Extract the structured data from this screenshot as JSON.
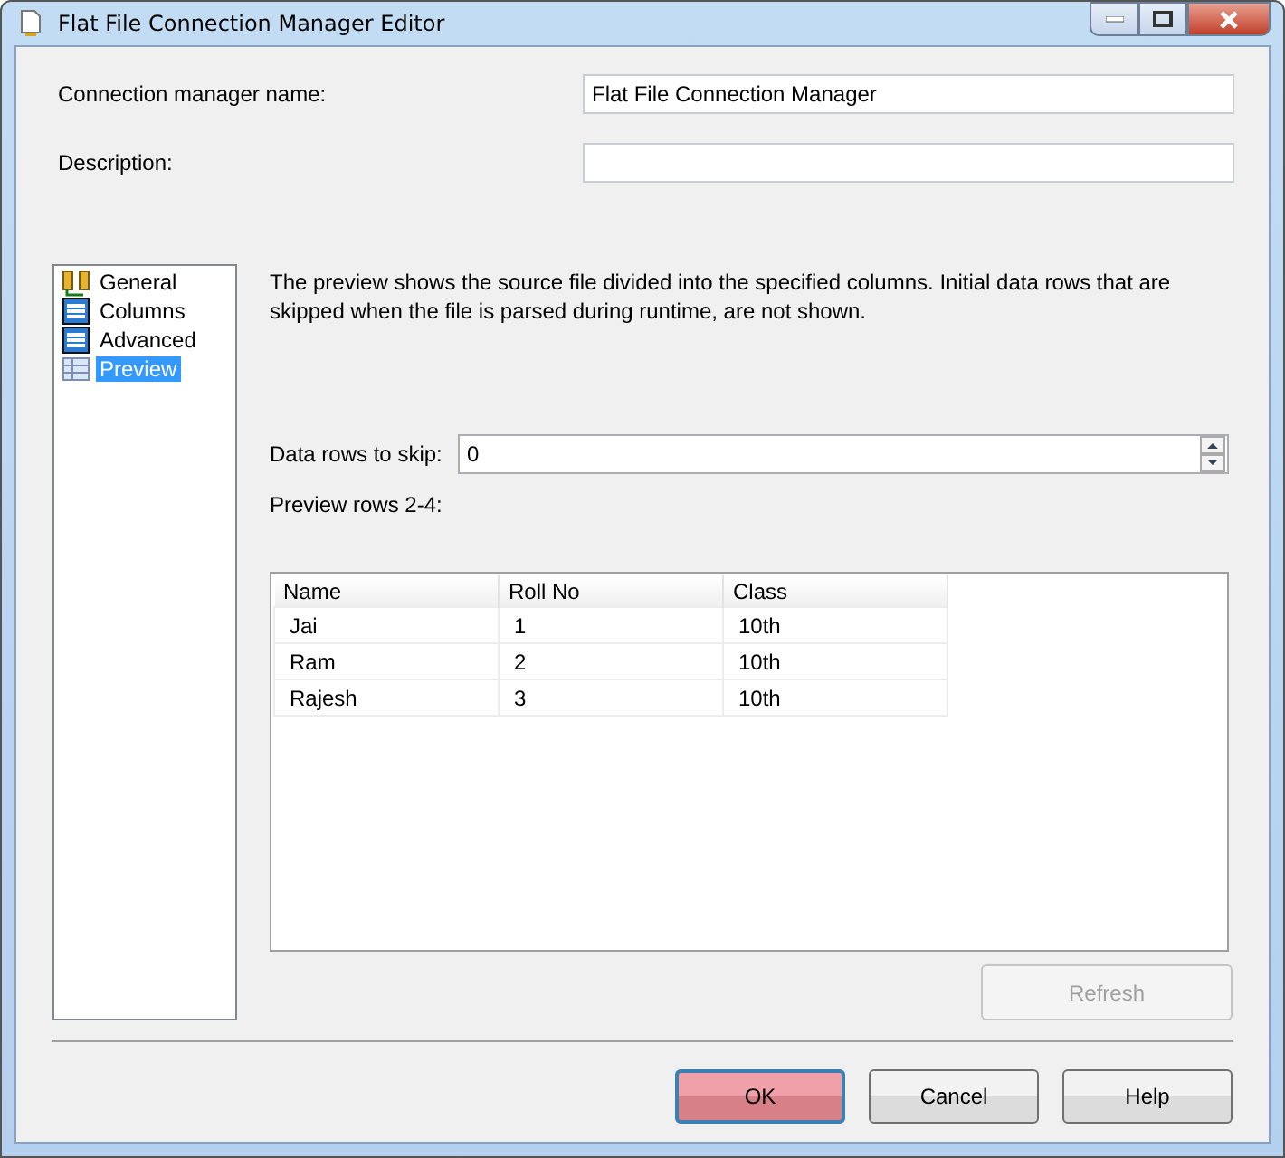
{
  "window": {
    "title": "Flat File Connection Manager Editor"
  },
  "fields": [
    {
      "label": "Connection manager name:",
      "value": "Flat File Connection Manager"
    },
    {
      "label": "Description:"
    }
  ],
  "sidebar": {
    "items": [
      {
        "label": "General",
        "kind": "general",
        "selected": false
      },
      {
        "label": "Columns",
        "kind": "grid",
        "selected": false
      },
      {
        "label": "Advanced",
        "kind": "grid",
        "selected": false
      },
      {
        "label": "Preview",
        "kind": "preview",
        "selected": true
      }
    ]
  },
  "description": "The preview shows the source file divided into the specified columns. Initial data rows that are skipped when the file is parsed during runtime, are not shown.",
  "skip": {
    "label": "Data rows to skip:",
    "value": "0"
  },
  "preview_label": "Preview rows 2-4:",
  "table": {
    "columns": [
      "Name",
      "Roll No",
      "Class"
    ],
    "rows": [
      [
        "Jai",
        "1",
        "10th"
      ],
      [
        "Ram",
        "2",
        "10th"
      ],
      [
        "Rajesh",
        "3",
        "10th"
      ]
    ]
  },
  "refresh": {
    "label": "Refresh",
    "disabled": true
  },
  "buttons": [
    {
      "label": "OK",
      "default": true
    },
    {
      "label": "Cancel",
      "default": false
    },
    {
      "label": "Help",
      "default": false
    }
  ]
}
